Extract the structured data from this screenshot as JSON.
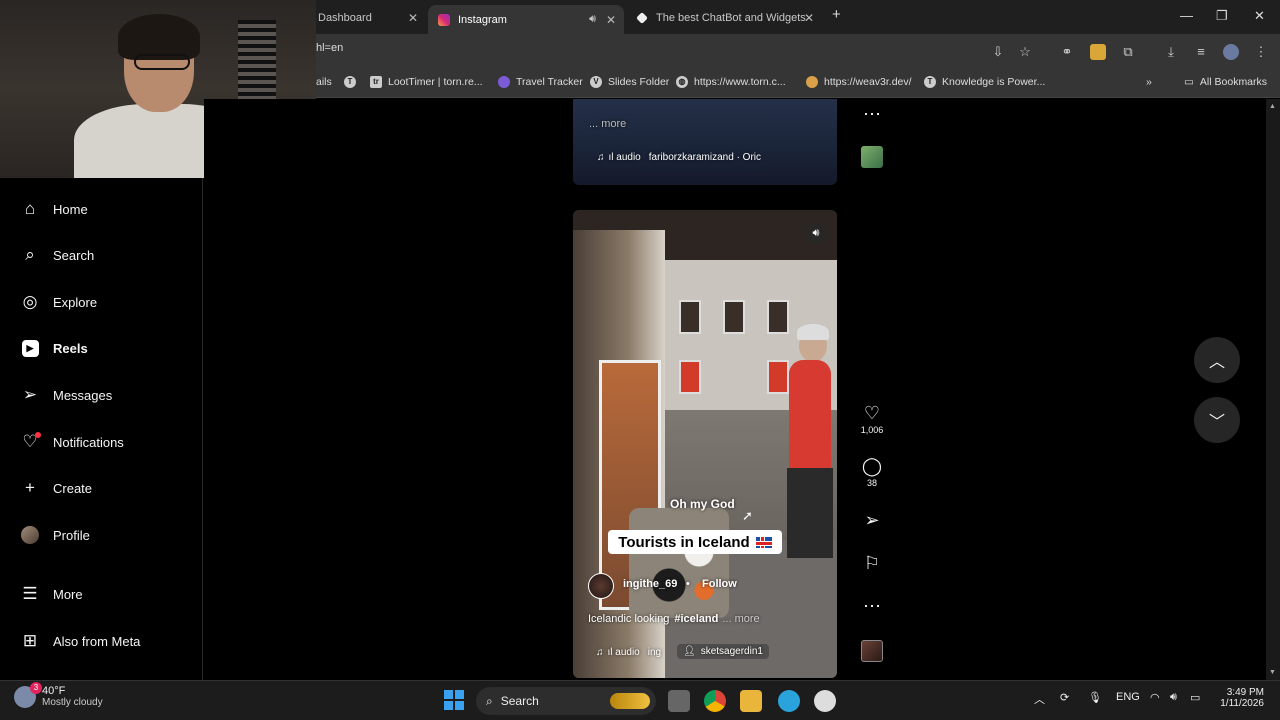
{
  "browser": {
    "tabs": [
      {
        "label": "Dashboard",
        "active": false
      },
      {
        "label": "Instagram",
        "active": true
      },
      {
        "label": "The best ChatBot and Widgets f",
        "active": false
      }
    ],
    "url": "hl=en",
    "bookmarks": [
      {
        "label": "ails",
        "icon": "partial"
      },
      {
        "label": "",
        "icon": "T"
      },
      {
        "label": "LootTimer | torn.re...",
        "icon": "tr"
      },
      {
        "label": "Travel Tracker",
        "icon": "tracker"
      },
      {
        "label": "Slides Folder",
        "icon": "V"
      },
      {
        "label": "https://www.torn.c...",
        "icon": "globe"
      },
      {
        "label": "https://weav3r.dev/",
        "icon": "cat"
      },
      {
        "label": "Knowledge is Power...",
        "icon": "T"
      }
    ],
    "all_bookmarks_label": "All Bookmarks"
  },
  "sidebar": {
    "items": [
      {
        "label": "Home",
        "icon": "home-icon"
      },
      {
        "label": "Search",
        "icon": "search-icon"
      },
      {
        "label": "Explore",
        "icon": "compass-icon"
      },
      {
        "label": "Reels",
        "icon": "reels-icon"
      },
      {
        "label": "Messages",
        "icon": "send-icon"
      },
      {
        "label": "Notifications",
        "icon": "heart-icon"
      },
      {
        "label": "Create",
        "icon": "plus-icon"
      },
      {
        "label": "Profile",
        "icon": "avatar-icon"
      },
      {
        "label": "More",
        "icon": "menu-icon"
      },
      {
        "label": "Also from Meta",
        "icon": "meta-icon"
      }
    ]
  },
  "reel_prev": {
    "more_label": "... more",
    "audio_prefix": "ıl audio",
    "audio_text": "fariborzkaramizand · Oric"
  },
  "reel": {
    "overlay_text": "Oh my God",
    "caption_box": "Tourists in Iceland",
    "username": "ingithe_69",
    "follow_label": "Follow",
    "caption": "Icelandic looking",
    "hashtag": "#iceland",
    "caption_more": "... more",
    "audio_prefix": "ıl audio",
    "audio_text": "ing",
    "tagged_user": "sketsagerdin1",
    "likes": "1,006",
    "comments": "38"
  },
  "taskbar": {
    "weather_temp": "40°F",
    "weather_desc": "Mostly cloudy",
    "weather_badge": "3",
    "search_label": "Search",
    "lang": "ENG",
    "time": "3:49 PM",
    "date": "1/11/2026"
  },
  "colors": {
    "background": "#000000",
    "chrome_dark": "#1f1f1f",
    "chrome_bar": "#353535",
    "notification_dot": "#ff3040"
  }
}
